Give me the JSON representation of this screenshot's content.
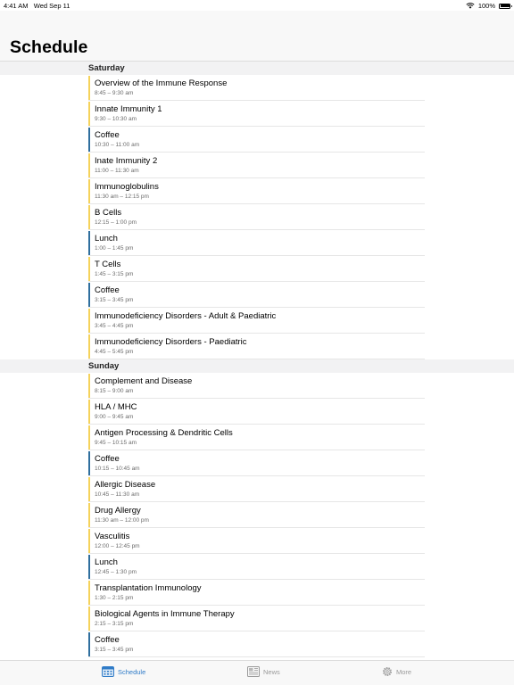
{
  "status_bar": {
    "time": "4:41 AM",
    "date": "Wed Sep 11",
    "battery": "100%",
    "battery_level": 1.0
  },
  "page": {
    "title": "Schedule"
  },
  "colors": {
    "session": "#f5d25b",
    "break": "#2f6f9e",
    "accent": "#2f7bc7"
  },
  "sections": [
    {
      "day": "Saturday",
      "rows": [
        {
          "title": "Overview of the Immune Response",
          "time": "8:45 – 9:30 am",
          "kind": "session"
        },
        {
          "title": "Innate Immunity 1",
          "time": "9:30 – 10:30 am",
          "kind": "session"
        },
        {
          "title": "Coffee",
          "time": "10:30 – 11:00 am",
          "kind": "break"
        },
        {
          "title": "Inate Immunity 2",
          "time": "11:00 – 11:30 am",
          "kind": "session"
        },
        {
          "title": "Immunoglobulins",
          "time": "11:30 am – 12:15 pm",
          "kind": "session"
        },
        {
          "title": "B Cells",
          "time": "12:15 – 1:00 pm",
          "kind": "session"
        },
        {
          "title": "Lunch",
          "time": "1:00 – 1:45 pm",
          "kind": "break"
        },
        {
          "title": "T Cells",
          "time": "1:45 – 3:15 pm",
          "kind": "session"
        },
        {
          "title": "Coffee",
          "time": "3:15 – 3:45 pm",
          "kind": "break"
        },
        {
          "title": "Immunodeficiency Disorders - Adult & Paediatric",
          "time": "3:45 – 4:45 pm",
          "kind": "session"
        },
        {
          "title": "Immunodeficiency Disorders - Paediatric",
          "time": "4:45 – 5:45 pm",
          "kind": "session"
        }
      ]
    },
    {
      "day": "Sunday",
      "rows": [
        {
          "title": "Complement and Disease",
          "time": "8:15 – 9:00 am",
          "kind": "session"
        },
        {
          "title": "HLA / MHC",
          "time": "9:00 – 9:45 am",
          "kind": "session"
        },
        {
          "title": "Antigen Processing & Dendritic Cells",
          "time": "9:45 – 10:15 am",
          "kind": "session"
        },
        {
          "title": "Coffee",
          "time": "10:15 – 10:45 am",
          "kind": "break"
        },
        {
          "title": "Allergic Disease",
          "time": "10:45 – 11:30 am",
          "kind": "session"
        },
        {
          "title": "Drug Allergy",
          "time": "11:30 am – 12:00 pm",
          "kind": "session"
        },
        {
          "title": "Vasculitis",
          "time": "12:00 – 12:45 pm",
          "kind": "session"
        },
        {
          "title": "Lunch",
          "time": "12:45 – 1:30 pm",
          "kind": "break"
        },
        {
          "title": "Transplantation Immunology",
          "time": "1:30 – 2:15 pm",
          "kind": "session"
        },
        {
          "title": "Biological Agents in Immune Therapy",
          "time": "2:15 – 3:15 pm",
          "kind": "session"
        },
        {
          "title": "Coffee",
          "time": "3:15 – 3:45 pm",
          "kind": "break"
        }
      ]
    }
  ],
  "tabs": [
    {
      "label": "Schedule",
      "icon": "calendar-icon",
      "active": true
    },
    {
      "label": "News",
      "icon": "newspaper-icon",
      "active": false
    },
    {
      "label": "More",
      "icon": "gear-icon",
      "active": false
    }
  ]
}
